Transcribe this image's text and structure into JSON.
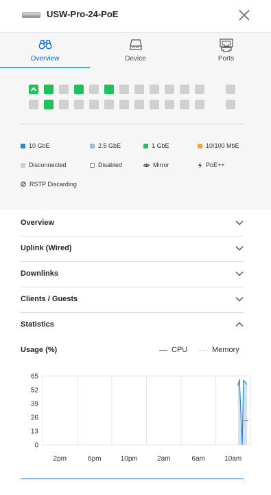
{
  "header": {
    "title": "USW-Pro-24-PoE"
  },
  "tabs": [
    {
      "label": "Overview",
      "icon": "binoculars-icon",
      "active": true
    },
    {
      "label": "Device",
      "icon": "switch-device-icon",
      "active": false
    },
    {
      "label": "Ports",
      "icon": "ethernet-port-icon",
      "active": false
    }
  ],
  "ports": {
    "top_row": [
      "uplink-green",
      "green",
      "off",
      "green",
      "off",
      "green",
      "off",
      "off",
      "off",
      "off",
      "off",
      "off",
      "off"
    ],
    "bottom_row": [
      "off",
      "green",
      "off",
      "off",
      "off",
      "off",
      "off",
      "off",
      "off",
      "off",
      "off",
      "off",
      "off"
    ]
  },
  "legend": [
    {
      "label": "10 GbE",
      "color": "#2e86c1",
      "type": "swatch"
    },
    {
      "label": "2.5 GbE",
      "color": "#8fc1ea",
      "type": "swatch"
    },
    {
      "label": "1 GbE",
      "color": "#1fc15c",
      "type": "swatch"
    },
    {
      "label": "10/100 MbE",
      "color": "#f2a53a",
      "type": "swatch"
    },
    {
      "label": "Disconnected",
      "color": "#cfcfcf",
      "type": "swatch"
    },
    {
      "label": "Disabled",
      "color": "#ffffff",
      "type": "outline"
    },
    {
      "label": "Mirror",
      "icon": "eye-icon",
      "type": "icon"
    },
    {
      "label": "PoE++",
      "icon": "bolt-icon",
      "type": "icon"
    },
    {
      "label": "RSTP Discarding",
      "icon": "blocked-icon",
      "type": "icon"
    }
  ],
  "sections": [
    {
      "label": "Overview",
      "expanded": false
    },
    {
      "label": "Uplink (Wired)",
      "expanded": false
    },
    {
      "label": "Downlinks",
      "expanded": false
    },
    {
      "label": "Clients / Guests",
      "expanded": false
    },
    {
      "label": "Statistics",
      "expanded": true
    }
  ],
  "statistics": {
    "title": "Usage (%)",
    "legend_cpu": "CPU",
    "legend_memory": "Memory",
    "cpu_color": "#2a7fd4",
    "memory_color": "#bdbdbd"
  },
  "chart_data": {
    "type": "line",
    "x_ticks": [
      "2pm",
      "6pm",
      "10pm",
      "2am",
      "6am",
      "10am"
    ],
    "y_ticks": [
      0,
      13,
      26,
      39,
      52,
      65
    ],
    "ylim": [
      0,
      65
    ],
    "grid": "vertical",
    "series": [
      {
        "name": "CPU",
        "x": [
          "10am",
          "10am",
          "10am",
          "10am",
          "10am"
        ],
        "values": [
          56,
          62,
          0,
          61,
          57
        ]
      },
      {
        "name": "Memory",
        "x": [
          "10am",
          "10am"
        ],
        "values": [
          23,
          23
        ]
      }
    ]
  }
}
